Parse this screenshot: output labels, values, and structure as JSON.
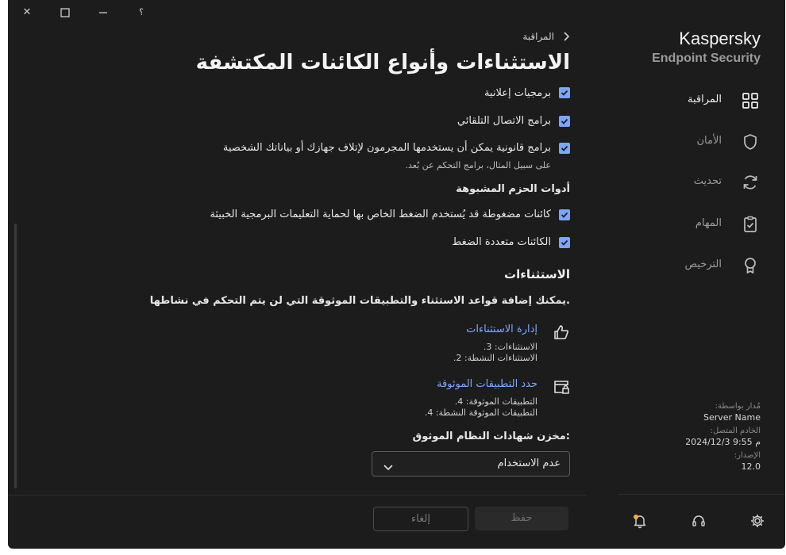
{
  "window": {
    "controls": {
      "help": "؟",
      "minimize": "—",
      "maximize": "☐",
      "close": "✕"
    }
  },
  "brand": {
    "line1": "Kaspersky",
    "line2": "Endpoint Security"
  },
  "sidebar": {
    "items": [
      {
        "label": "المراقبة",
        "icon": "grid-icon",
        "active": true
      },
      {
        "label": "الأمان",
        "icon": "shield-icon",
        "active": false
      },
      {
        "label": "تحديث",
        "icon": "refresh-icon",
        "active": false
      },
      {
        "label": "المهام",
        "icon": "clipboard-check-icon",
        "active": false
      },
      {
        "label": "الترخيص",
        "icon": "award-icon",
        "active": false
      }
    ],
    "server": {
      "managed_by_label": "مُدار بواسطة:",
      "managed_by_value": "Server Name",
      "connected_label": "الخادم المتصل:",
      "connected_value": "2024/12/3 9:55 م",
      "version_label": "الإصدار:",
      "version_value": "12.0"
    }
  },
  "header": {
    "breadcrumb": "المراقبة",
    "title": "الاستثناءات وأنواع الكائنات المكتشفة"
  },
  "content": {
    "checkboxes_top": [
      {
        "label": "برمجيات إعلانية",
        "checked": true
      },
      {
        "label": "برامج الاتصال التلقائي",
        "checked": true
      },
      {
        "label": "برامج قانونية يمكن أن يستخدمها المجرمون لإتلاف جهازك أو بياناتك الشخصية",
        "note": "على سبيل المثال، برامج التحكم عن بُعد.",
        "checked": true
      }
    ],
    "packers_title": "أدوات الحزم المشبوهة",
    "checkboxes_packers": [
      {
        "label": "كائنات مضغوطة قد يُستخدم الضغط الخاص بها لحماية التعليمات البرمجية الخبيثة",
        "checked": true
      },
      {
        "label": "الكائنات متعددة الضغط",
        "checked": true
      }
    ],
    "exclusions_title": "الاستثناءات",
    "exclusions_desc": "يمكنك إضافة قواعد الاستثناء والتطبيقات الموثوقة التي لن يتم التحكم في نشاطها.",
    "manage_exclusions": {
      "link": "إدارة الاستثناءات",
      "line1": "الاستثناءات: 3.",
      "line2": "الاستثناءات النشطة: 2."
    },
    "trusted_apps": {
      "link": "حدد التطبيقات الموثوقة",
      "line1": "التطبيقات الموثوقة: 4.",
      "line2": "التطبيقات الموثوقة النشطة: 4."
    },
    "cert_store_label": "مخزن شهادات النظام الموثوق:",
    "cert_store_value": "عدم الاستخدام"
  },
  "footer": {
    "save_label": "حفظ",
    "cancel_label": "إلغاء"
  },
  "colors": {
    "accent": "#7aa6ff",
    "link": "#7fa8ff",
    "background": "#1c1c1c"
  }
}
